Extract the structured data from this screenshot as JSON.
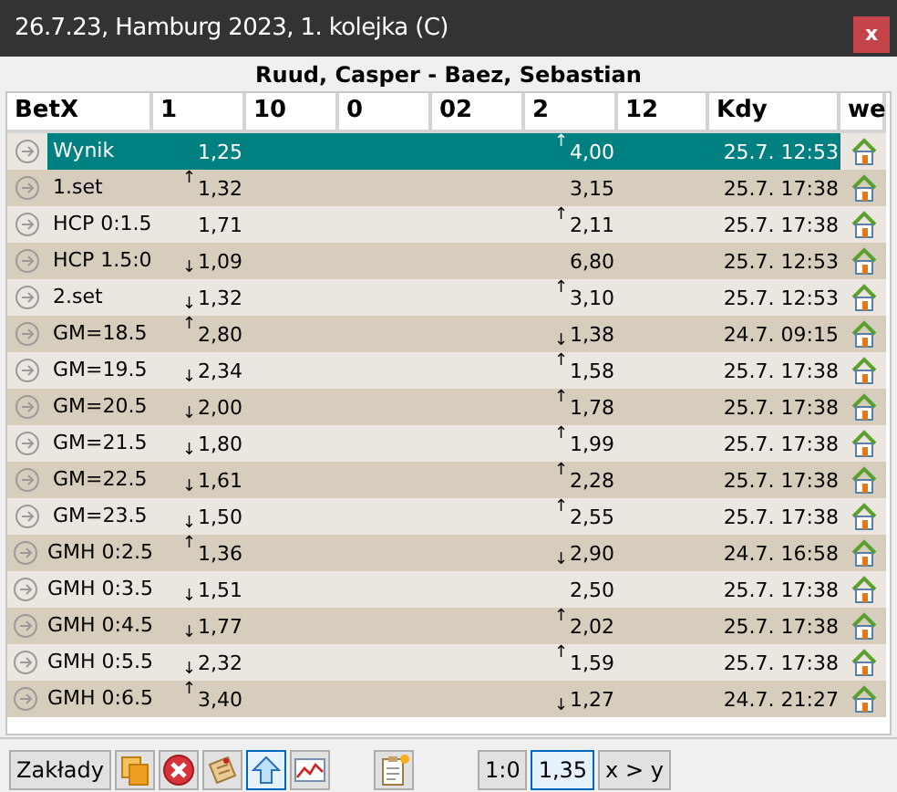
{
  "window": {
    "title": "26.7.23, Hamburg 2023, 1. kolejka (C)",
    "close": "x"
  },
  "match": "Ruud, Casper - Baez, Sebastian",
  "table": {
    "columns": [
      "BetX",
      "1",
      "10",
      "0",
      "02",
      "2",
      "12",
      "Kdy",
      "we"
    ],
    "rows": [
      {
        "name": "Wynik",
        "odd_1": {
          "value": "1,25"
        },
        "odd_2": {
          "value": "4,00",
          "arrow": "↑",
          "raised": true
        },
        "time": "25.7. 12:53",
        "selected": true
      },
      {
        "name": "1.set",
        "odd_1": {
          "value": "1,32",
          "arrow": "↑",
          "raised": true
        },
        "odd_2": {
          "value": "3,15"
        },
        "time": "25.7. 17:38",
        "selected": false
      },
      {
        "name": "HCP 0:1.5",
        "odd_1": {
          "value": "1,71"
        },
        "odd_2": {
          "value": "2,11",
          "arrow": "↑",
          "raised": true
        },
        "time": "25.7. 17:38",
        "selected": false
      },
      {
        "name": "HCP 1.5:0",
        "odd_1": {
          "value": "1,09",
          "arrow": "↓",
          "raised": false
        },
        "odd_2": {
          "value": "6,80"
        },
        "time": "25.7. 12:53",
        "selected": false
      },
      {
        "name": "2.set",
        "odd_1": {
          "value": "1,32",
          "arrow": "↓",
          "raised": false
        },
        "odd_2": {
          "value": "3,10",
          "arrow": "↑",
          "raised": true
        },
        "time": "25.7. 12:53",
        "selected": false
      },
      {
        "name": "GM=18.5",
        "odd_1": {
          "value": "2,80",
          "arrow": "↑",
          "raised": true
        },
        "odd_2": {
          "value": "1,38",
          "arrow": "↓",
          "raised": false
        },
        "time": "24.7. 09:15",
        "selected": false
      },
      {
        "name": "GM=19.5",
        "odd_1": {
          "value": "2,34",
          "arrow": "↓",
          "raised": false
        },
        "odd_2": {
          "value": "1,58",
          "arrow": "↑",
          "raised": true
        },
        "time": "25.7. 17:38",
        "selected": false
      },
      {
        "name": "GM=20.5",
        "odd_1": {
          "value": "2,00",
          "arrow": "↓",
          "raised": false
        },
        "odd_2": {
          "value": "1,78",
          "arrow": "↑",
          "raised": true
        },
        "time": "25.7. 17:38",
        "selected": false
      },
      {
        "name": "GM=21.5",
        "odd_1": {
          "value": "1,80",
          "arrow": "↓",
          "raised": false
        },
        "odd_2": {
          "value": "1,99",
          "arrow": "↑",
          "raised": true
        },
        "time": "25.7. 17:38",
        "selected": false
      },
      {
        "name": "GM=22.5",
        "odd_1": {
          "value": "1,61",
          "arrow": "↓",
          "raised": false
        },
        "odd_2": {
          "value": "2,28",
          "arrow": "↑",
          "raised": true
        },
        "time": "25.7. 17:38",
        "selected": false
      },
      {
        "name": "GM=23.5",
        "odd_1": {
          "value": "1,50",
          "arrow": "↓",
          "raised": false
        },
        "odd_2": {
          "value": "2,55",
          "arrow": "↑",
          "raised": true
        },
        "time": "25.7. 17:38",
        "selected": false
      },
      {
        "name": "GMH 0:2.5",
        "odd_1": {
          "value": "1,36",
          "arrow": "↑",
          "raised": true
        },
        "odd_2": {
          "value": "2,90",
          "arrow": "↓",
          "raised": false
        },
        "time": "24.7. 16:58",
        "selected": false
      },
      {
        "name": "GMH 0:3.5",
        "odd_1": {
          "value": "1,51",
          "arrow": "↓",
          "raised": false
        },
        "odd_2": {
          "value": "2,50"
        },
        "time": "25.7. 17:38",
        "selected": false
      },
      {
        "name": "GMH 0:4.5",
        "odd_1": {
          "value": "1,77",
          "arrow": "↓",
          "raised": false
        },
        "odd_2": {
          "value": "2,02",
          "arrow": "↑",
          "raised": true
        },
        "time": "25.7. 17:38",
        "selected": false
      },
      {
        "name": "GMH 0:5.5",
        "odd_1": {
          "value": "2,32",
          "arrow": "↓",
          "raised": false
        },
        "odd_2": {
          "value": "1,59",
          "arrow": "↑",
          "raised": true
        },
        "time": "25.7. 17:38",
        "selected": false
      },
      {
        "name": "GMH 0:6.5",
        "odd_1": {
          "value": "3,40",
          "arrow": "↑",
          "raised": true
        },
        "odd_2": {
          "value": "1,27",
          "arrow": "↓",
          "raised": false
        },
        "time": "24.7. 21:27",
        "selected": false
      }
    ]
  },
  "toolbar": {
    "label_button": "Zakłady",
    "icon_buttons": [
      {
        "kind": "pages",
        "pressed": false
      },
      {
        "kind": "delete",
        "pressed": false
      },
      {
        "kind": "note",
        "pressed": false
      },
      {
        "kind": "up",
        "pressed": true
      },
      {
        "kind": "chart",
        "pressed": false
      },
      {
        "kind": "clipboard",
        "pressed": false
      }
    ],
    "text_buttons": [
      {
        "label": "1:0",
        "pressed": false
      },
      {
        "label": "1,35",
        "pressed": true
      },
      {
        "label": "x > y",
        "pressed": false
      }
    ]
  }
}
